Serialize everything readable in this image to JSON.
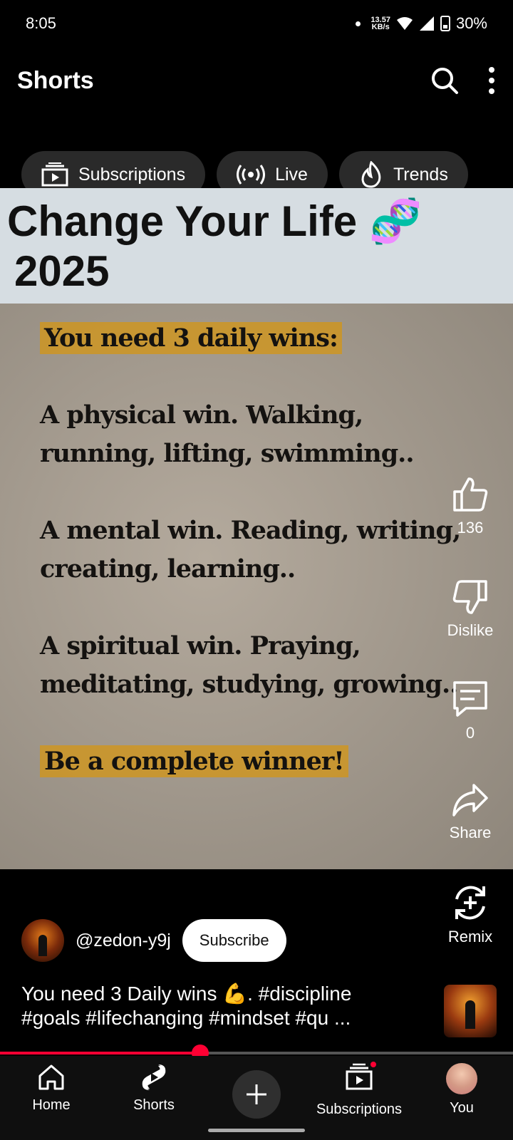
{
  "status_bar": {
    "time": "8:05",
    "net_speed_value": "13.57",
    "net_speed_unit": "KB/s",
    "battery": "30%"
  },
  "header": {
    "title": "Shorts",
    "icons": [
      "search-icon",
      "more-vert-icon"
    ]
  },
  "chips": [
    {
      "label": "Subscriptions",
      "icon": "subscriptions-icon"
    },
    {
      "label": "Live",
      "icon": "live-icon"
    },
    {
      "label": "Trends",
      "icon": "trends-icon"
    }
  ],
  "video": {
    "title_line1": "Change Your Life 🧬",
    "title_line2": "2025",
    "lines": [
      "You need 3 daily wins:",
      "A physical win. Walking, running, lifting, swimming..",
      "A mental win. Reading, writing, creating, learning..",
      "A spiritual win. Praying, meditating, studying, growing..",
      "Be a complete winner!"
    ]
  },
  "actions": {
    "like_count": "136",
    "dislike_label": "Dislike",
    "comment_count": "0",
    "share_label": "Share",
    "remix_label": "Remix"
  },
  "channel": {
    "handle": "@zedon-y9j",
    "subscribe_label": "Subscribe"
  },
  "caption": {
    "line1": "You need 3 Daily wins 💪. #discipline",
    "line2": "#goals #lifechanging #mindset #qu ..."
  },
  "progress": {
    "fraction": 0.39
  },
  "nav": {
    "home": "Home",
    "shorts": "Shorts",
    "subscriptions": "Subscriptions",
    "you": "You"
  },
  "colors": {
    "accent": "#ff0033",
    "highlight": "#d49614",
    "title_band": "#d6dde2"
  }
}
